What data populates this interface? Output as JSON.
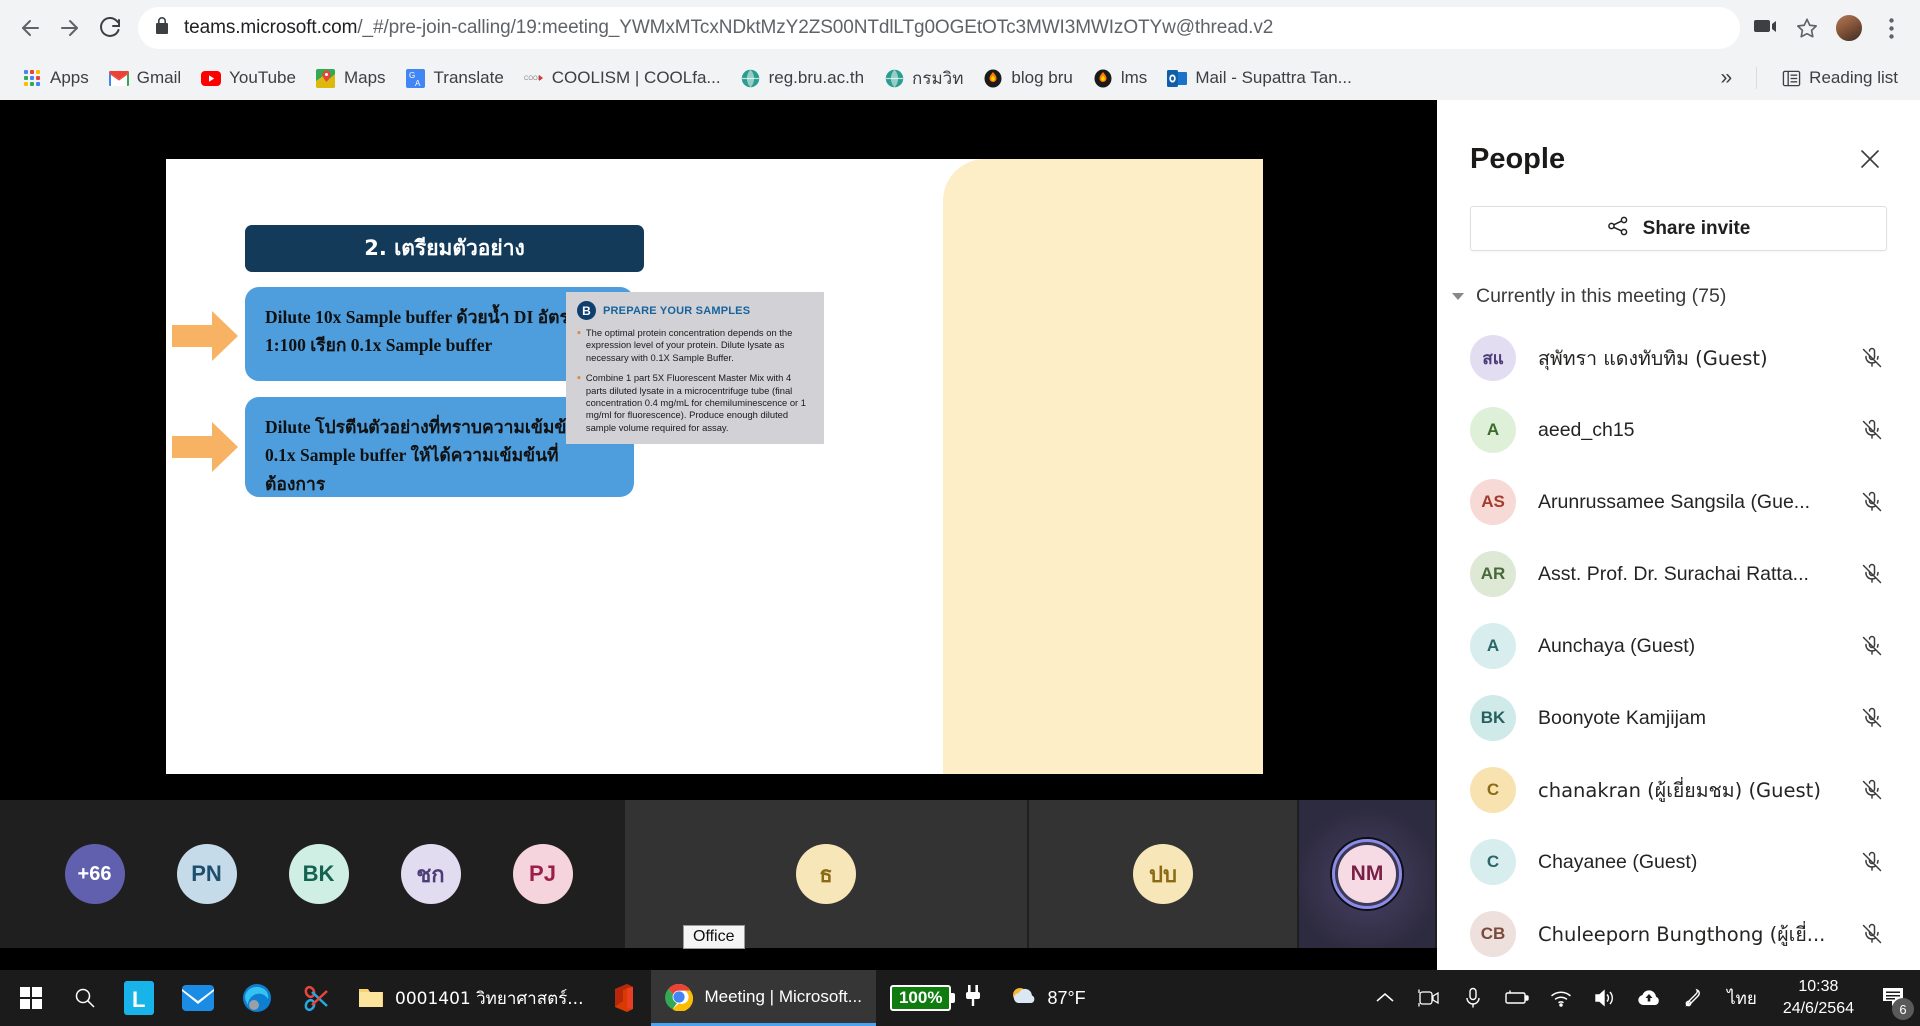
{
  "browser": {
    "url_host": "teams.microsoft.com",
    "url_path": "/_#/pre-join-calling/19:meeting_YWMxMTcxNDktMzY2ZS00NTdlLTg0OGEtOTc3MWI3MWIzOTYw@thread.v2",
    "back_icon": "back-arrow-icon",
    "forward_icon": "forward-arrow-icon",
    "reload_icon": "reload-icon",
    "lock_icon": "lock-icon",
    "cast_icon": "cast-icon",
    "star_icon": "star-icon",
    "menu_icon": "kebab-menu-icon",
    "bookmarks": [
      {
        "label": "Apps",
        "icon": "apps-grid-icon"
      },
      {
        "label": "Gmail",
        "icon": "gmail-icon"
      },
      {
        "label": "YouTube",
        "icon": "youtube-icon"
      },
      {
        "label": "Maps",
        "icon": "maps-icon"
      },
      {
        "label": "Translate",
        "icon": "translate-icon"
      },
      {
        "label": "COOLISM | COOLfa...",
        "icon": "coolism-icon"
      },
      {
        "label": "reg.bru.ac.th",
        "icon": "globe-icon"
      },
      {
        "label": "กรมวิท",
        "icon": "globe-icon"
      },
      {
        "label": "blog bru",
        "icon": "flame-icon"
      },
      {
        "label": "lms",
        "icon": "flame-icon"
      },
      {
        "label": "Mail - Supattra Tan...",
        "icon": "outlook-icon"
      }
    ],
    "overflow_label": "»",
    "reading_list_label": "Reading list",
    "reading_list_icon": "reading-list-icon"
  },
  "slide": {
    "title": "2. เตรียมตัวอย่าง",
    "box1": "Dilute 10x Sample buffer ด้วยน้ำ DI อัตราส่วน 1:100 เรียก 0.1x Sample buffer",
    "box2": "Dilute โปรตีนตัวอย่างที่ทราบความเข้มข้นกับ 0.1x Sample buffer ให้ได้ความเข้มข้นที่ต้องการ",
    "prepare": {
      "badge": "B",
      "title": "PREPARE YOUR SAMPLES",
      "bullets": [
        "The optimal protein concentration depends on the expression level of your protein. Dilute lysate as necessary with 0.1X Sample Buffer.",
        "Combine 1 part 5X Fluorescent Master Mix with 4 parts diluted lysate in a microcentrifuge tube (final concentration 0.4 mg/mL for chemiluminescence or 1 mg/ml for fluorescence). Produce enough diluted sample volume required for assay."
      ]
    }
  },
  "filmstrip": {
    "overflow_count": "+66",
    "tiles": [
      {
        "initials": "PN",
        "bg": "#c5dbea",
        "fg": "#1f4f6e"
      },
      {
        "initials": "BK",
        "bg": "#cfeee4",
        "fg": "#14624f"
      },
      {
        "initials": "ชก",
        "bg": "#e2dcf0",
        "fg": "#4b3d78"
      },
      {
        "initials": "PJ",
        "bg": "#f6d4dd",
        "fg": "#9c1c4a"
      },
      {
        "initials": "ธ",
        "bg": "#f7e6b8",
        "fg": "#8a6a14"
      },
      {
        "initials": "ปบ",
        "bg": "#f7e6b8",
        "fg": "#8a6a14"
      },
      {
        "initials": "NM",
        "bg": "#f6dbe4",
        "fg": "#7a1f45"
      }
    ],
    "tooltip": "Office"
  },
  "people": {
    "title": "People",
    "close_icon": "close-icon",
    "share_label": "Share invite",
    "share_icon": "share-icon",
    "section_label": "Currently in this meeting (75)",
    "participants": [
      {
        "name": "สุพัทรา แดงทับทิม (Guest)",
        "initials": "สแ",
        "bg": "#e3ddf2",
        "fg": "#4a3d7a",
        "thai": true
      },
      {
        "name": "aeed_ch15",
        "initials": "A",
        "bg": "#dff0d8",
        "fg": "#3d6b2e",
        "thai": false
      },
      {
        "name": "Arunrussamee Sangsila (Gue...",
        "initials": "AS",
        "bg": "#f7d9d5",
        "fg": "#a33b2e",
        "thai": false
      },
      {
        "name": "Asst. Prof. Dr. Surachai Ratta...",
        "initials": "AR",
        "bg": "#dde8d5",
        "fg": "#49683a",
        "thai": false
      },
      {
        "name": "Aunchaya (Guest)",
        "initials": "A",
        "bg": "#d7edee",
        "fg": "#2c6669",
        "thai": false
      },
      {
        "name": "Boonyote Kamjijam",
        "initials": "BK",
        "bg": "#cfeae9",
        "fg": "#28605f",
        "thai": false
      },
      {
        "name": "chanakran (ผู้เยี่ยมชม) (Guest)",
        "initials": "C",
        "bg": "#f8e3b0",
        "fg": "#8c6a17",
        "thai": true
      },
      {
        "name": "Chayanee (Guest)",
        "initials": "C",
        "bg": "#d7edee",
        "fg": "#2c6669",
        "thai": false
      },
      {
        "name": "Chuleeporn Bungthong (ผู้เยี่...",
        "initials": "CB",
        "bg": "#eee0dc",
        "fg": "#7b4a3c",
        "thai": true
      }
    ],
    "mic_off_icon": "mic-off-icon"
  },
  "taskbar": {
    "start_icon": "windows-start-icon",
    "search_icon": "search-icon",
    "pinned": [
      {
        "name": "line-icon"
      },
      {
        "name": "mail-icon"
      },
      {
        "name": "edge-icon"
      },
      {
        "name": "snip-sketch-icon"
      }
    ],
    "windows": [
      {
        "label": "0001401 วิทยาศาสตร์...",
        "icon": "folder-icon",
        "active": false
      },
      {
        "label": "",
        "icon": "office-icon",
        "active": false
      },
      {
        "label": "Meeting | Microsoft...",
        "icon": "chrome-icon",
        "active": true
      }
    ],
    "battery_percent": "100%",
    "plug_icon": "power-plug-icon",
    "weather_temp": "87°F",
    "weather_icon": "partly-cloudy-icon",
    "tray_icons": [
      "chevron-up-icon",
      "camera-icon",
      "microphone-icon",
      "battery-charging-icon",
      "wifi-icon",
      "volume-icon",
      "onedrive-icon",
      "pen-icon"
    ],
    "language": "ไทย",
    "time": "10:38",
    "date": "24/6/2564",
    "notification_count": "6",
    "notification_icon": "notification-icon"
  }
}
